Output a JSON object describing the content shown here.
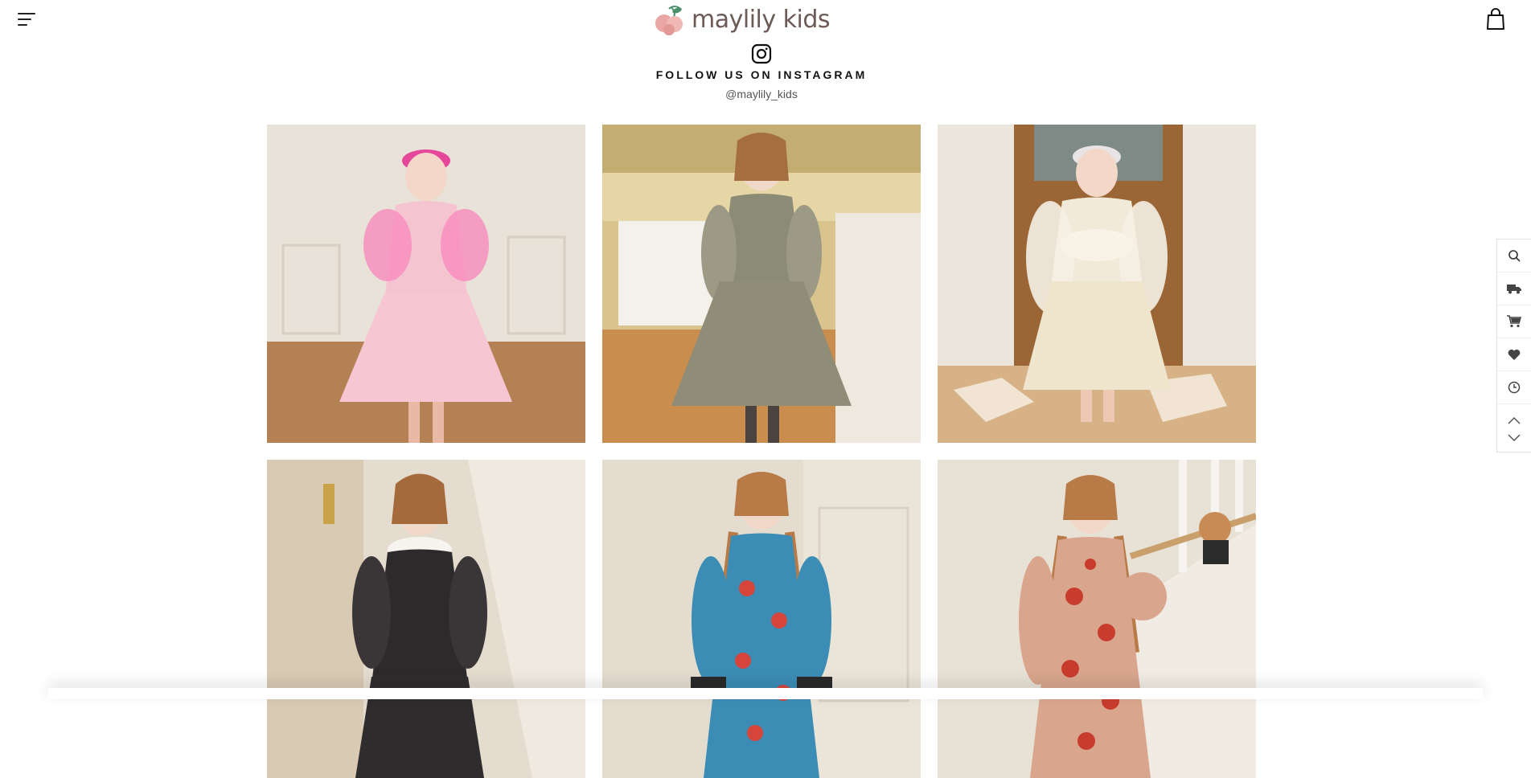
{
  "header": {
    "brand": "maylily kids",
    "menu_icon": "hamburger-menu-icon",
    "bag_icon": "shopping-bag-icon"
  },
  "instagram": {
    "icon": "instagram-icon",
    "title": "FOLLOW US ON INSTAGRAM",
    "handle": "@maylily_kids"
  },
  "gallery": {
    "items": [
      {
        "name": "pink-tulle-dress-photo"
      },
      {
        "name": "floral-jacquard-dress-photo"
      },
      {
        "name": "cream-lace-bow-dress-photo"
      },
      {
        "name": "black-tweed-collar-dress-photo"
      },
      {
        "name": "blue-strawberry-dress-photo"
      },
      {
        "name": "red-strawberry-dress-photo"
      }
    ]
  },
  "quick_menu": {
    "items": [
      "search-icon",
      "delivery-truck-icon",
      "cart-icon",
      "heart-icon",
      "recent-clock-icon"
    ],
    "arrows": [
      "chevron-up-icon",
      "chevron-down-icon"
    ]
  },
  "colors": {
    "brand_text": "#6b5a55",
    "logo_pink": "#e9a6a4",
    "logo_green": "#4a8f6a"
  }
}
